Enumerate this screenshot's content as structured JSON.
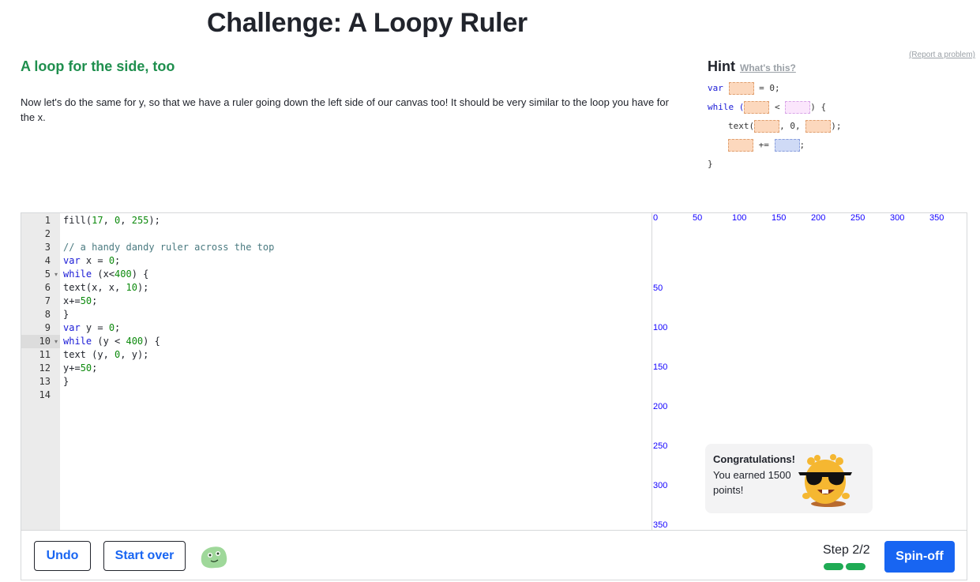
{
  "page": {
    "title": "Challenge: A Loopy Ruler",
    "step_title": "A loop for the side, too",
    "instructions": "Now let's do the same for y, so that we have a ruler going down the left side of our canvas too! It should be very similar to the loop you have for the x.",
    "report_link": "(Report a problem)"
  },
  "hint": {
    "title": "Hint",
    "whats_this": "What's this?",
    "code": {
      "var_kw": "var",
      "var_rest": "= 0;",
      "while_kw": "while (",
      "lt": "<",
      "while_end": ") {",
      "text_open": "text(",
      "text_mid": ", 0,",
      "text_end": ");",
      "plus_eq": "+=",
      "semi": ";",
      "close": "}"
    }
  },
  "editor": {
    "line_numbers": [
      "1",
      "2",
      "3",
      "4",
      "5",
      "6",
      "7",
      "8",
      "9",
      "10",
      "11",
      "12",
      "13",
      "14"
    ],
    "active_line": "10",
    "lines": [
      {
        "a": "fill(",
        "n1": "17",
        "b": ", ",
        "n2": "0",
        "c": ", ",
        "n3": "255",
        "d": ");"
      },
      {},
      {
        "comment": "// a handy dandy ruler across the top"
      },
      {
        "kw": "var",
        "rest": " x = ",
        "num": "0",
        "end": ";"
      },
      {
        "kw": "while",
        "rest": " (x<",
        "num": "400",
        "end": ") {"
      },
      {
        "a": "text(x, x, ",
        "num": "10",
        "end": ");"
      },
      {
        "a": "x+=",
        "num": "50",
        "end": ";"
      },
      {
        "a": "}"
      },
      {
        "kw": "var",
        "rest": " y = ",
        "num": "0",
        "end": ";"
      },
      {
        "kw": "while",
        "rest": " (y < ",
        "num": "400",
        "end": ") {"
      },
      {
        "a": "text (y, ",
        "num": "0",
        "end": ", y);"
      },
      {
        "a": "y+=",
        "num": "50",
        "end": ";"
      },
      {
        "a": "}"
      },
      {}
    ]
  },
  "canvas": {
    "text_color": "#1100ff",
    "x_ticks": [
      "0",
      "50",
      "100",
      "150",
      "200",
      "250",
      "300",
      "350"
    ],
    "y_ticks": [
      "50",
      "100",
      "150",
      "200",
      "250",
      "300",
      "350"
    ]
  },
  "toast": {
    "title": "Congratulations!",
    "message": "You earned 1500 points!",
    "mascot_icon": "sunglasses-monster-icon"
  },
  "toolbar": {
    "undo_label": "Undo",
    "start_over_label": "Start over",
    "avatar_icon": "green-blob-avatar-icon",
    "step_label": "Step 2/2",
    "progress_completed": 2,
    "progress_total": 2,
    "spinoff_label": "Spin-off",
    "accent_color": "#1865f2",
    "progress_color": "#1fab54"
  }
}
